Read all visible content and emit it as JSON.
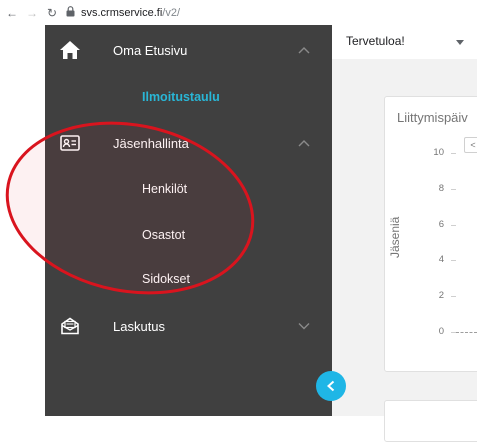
{
  "browser": {
    "url_domain": "svs.crmservice.fi",
    "url_path": "/v2/"
  },
  "sidebar": {
    "items": [
      {
        "label": "Oma Etusivu",
        "icon": "home-icon",
        "expanded": true,
        "subitems": [
          {
            "label": "Ilmoitustaulu",
            "active": true
          }
        ]
      },
      {
        "label": "Jäsenhallinta",
        "icon": "id-card-icon",
        "expanded": true,
        "subitems": [
          {
            "label": "Henkilöt",
            "active": false
          },
          {
            "label": "Osastot",
            "active": false
          },
          {
            "label": "Sidokset",
            "active": false
          }
        ]
      },
      {
        "label": "Laskutus",
        "icon": "envelope-icon",
        "expanded": false,
        "subitems": []
      }
    ]
  },
  "header": {
    "welcome": "Tervetuloa!"
  },
  "card": {
    "title": "Liittymispäiv",
    "tooltip_glyph": "<"
  },
  "chart_data": {
    "type": "line",
    "ylabel": "Jäseniä",
    "yticks": [
      "10",
      "8",
      "6",
      "4",
      "2",
      "0"
    ],
    "ylim": [
      0,
      10
    ],
    "series": [
      {
        "values": [
          0,
          0
        ]
      }
    ]
  },
  "colors": {
    "sidebar_bg": "#404040",
    "active_link": "#29b6d6",
    "collapse_button": "#1fb6e6",
    "annotation": "#d9141e"
  }
}
